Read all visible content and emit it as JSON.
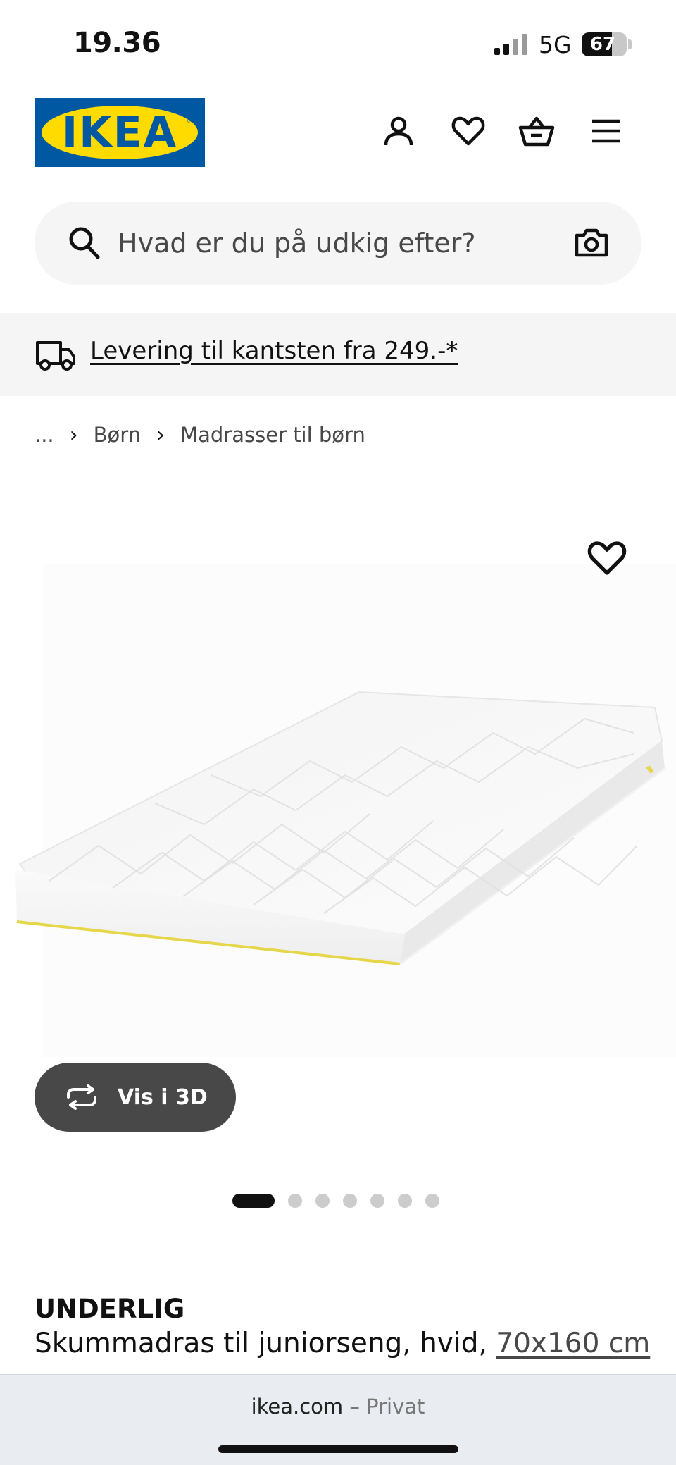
{
  "status_bar": {
    "time": "19.36",
    "network": "5G",
    "battery_level": "67",
    "battery_fraction": 0.67
  },
  "header": {
    "logo_text": "IKEA",
    "logo_reg": "®",
    "icons": [
      "user-icon",
      "heart-icon",
      "basket-icon",
      "menu-icon"
    ]
  },
  "search": {
    "placeholder": "Hvad er du på udkig efter?",
    "value": ""
  },
  "delivery": {
    "text": "Levering til kantsten fra 249.-*"
  },
  "breadcrumb": {
    "ellipsis": "...",
    "items": [
      "Børn",
      "Madrasser til børn"
    ]
  },
  "gallery": {
    "view_3d_label": "Vis i 3D",
    "total_images": 7,
    "active_index": 0
  },
  "product": {
    "name": "UNDERLIG",
    "description": "Skummadras til juniorseng, hvid,",
    "size_link": "70x160 cm"
  },
  "browser": {
    "domain": "ikea.com",
    "separator": "–",
    "mode": "Privat"
  },
  "colors": {
    "ikea_blue": "#0058a3",
    "ikea_yellow": "#ffdb00",
    "dark_button": "#484848",
    "banner_bg": "#f5f5f5"
  }
}
